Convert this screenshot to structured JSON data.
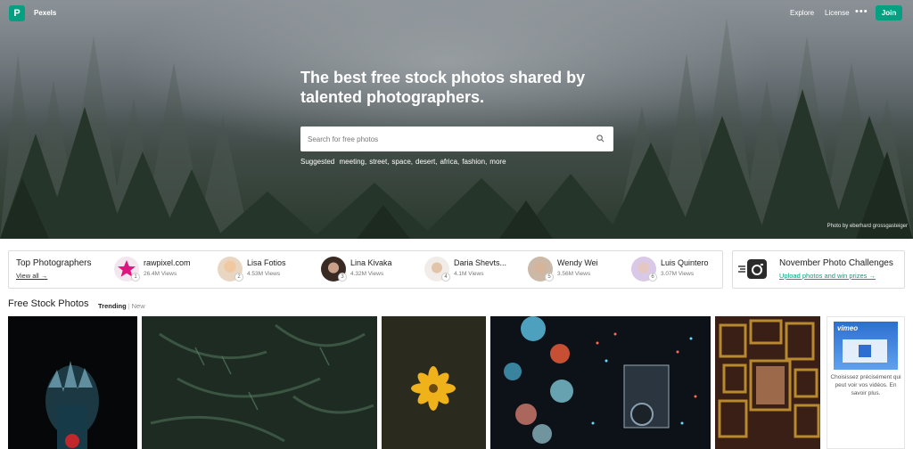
{
  "header": {
    "brand": "Pexels",
    "logo_letter": "P",
    "nav": [
      "Explore",
      "License"
    ],
    "more_label": "•••",
    "join_label": "Join"
  },
  "hero": {
    "headline": "The best free stock photos shared by talented photographers.",
    "search_placeholder": "Search for free photos",
    "suggested_label": "Suggested",
    "suggestions": [
      "meeting,",
      "street,",
      "space,",
      "desert,",
      "africa,",
      "fashion,",
      "more"
    ],
    "credit": "Photo by eberhard grossgasteiger"
  },
  "top_photographers": {
    "title": "Top Photographers",
    "view_all": "View all →",
    "items": [
      {
        "name": "rawpixel.com",
        "views": "26.4M Views",
        "rank": "1"
      },
      {
        "name": "Lisa Fotios",
        "views": "4.53M Views",
        "rank": "2"
      },
      {
        "name": "Lina Kivaka",
        "views": "4.32M Views",
        "rank": "3"
      },
      {
        "name": "Daria Shevts...",
        "views": "4.1M Views",
        "rank": "4"
      },
      {
        "name": "Wendy Wei",
        "views": "3.56M Views",
        "rank": "5"
      },
      {
        "name": "Luis Quintero",
        "views": "3.07M Views",
        "rank": "6"
      }
    ]
  },
  "challenges": {
    "title": "November Photo Challenges",
    "link": "Upload photos and win prizes →"
  },
  "feed": {
    "title": "Free Stock Photos",
    "tabs": [
      "Trending",
      "New"
    ],
    "separator": "|"
  },
  "ad": {
    "brand": "vimeo",
    "text": "Choisissez précisément qui peut voir vos vidéos. En savoir plus."
  },
  "colors": {
    "brand_green": "#05a081",
    "rawpixel_pink": "#e1137f"
  }
}
